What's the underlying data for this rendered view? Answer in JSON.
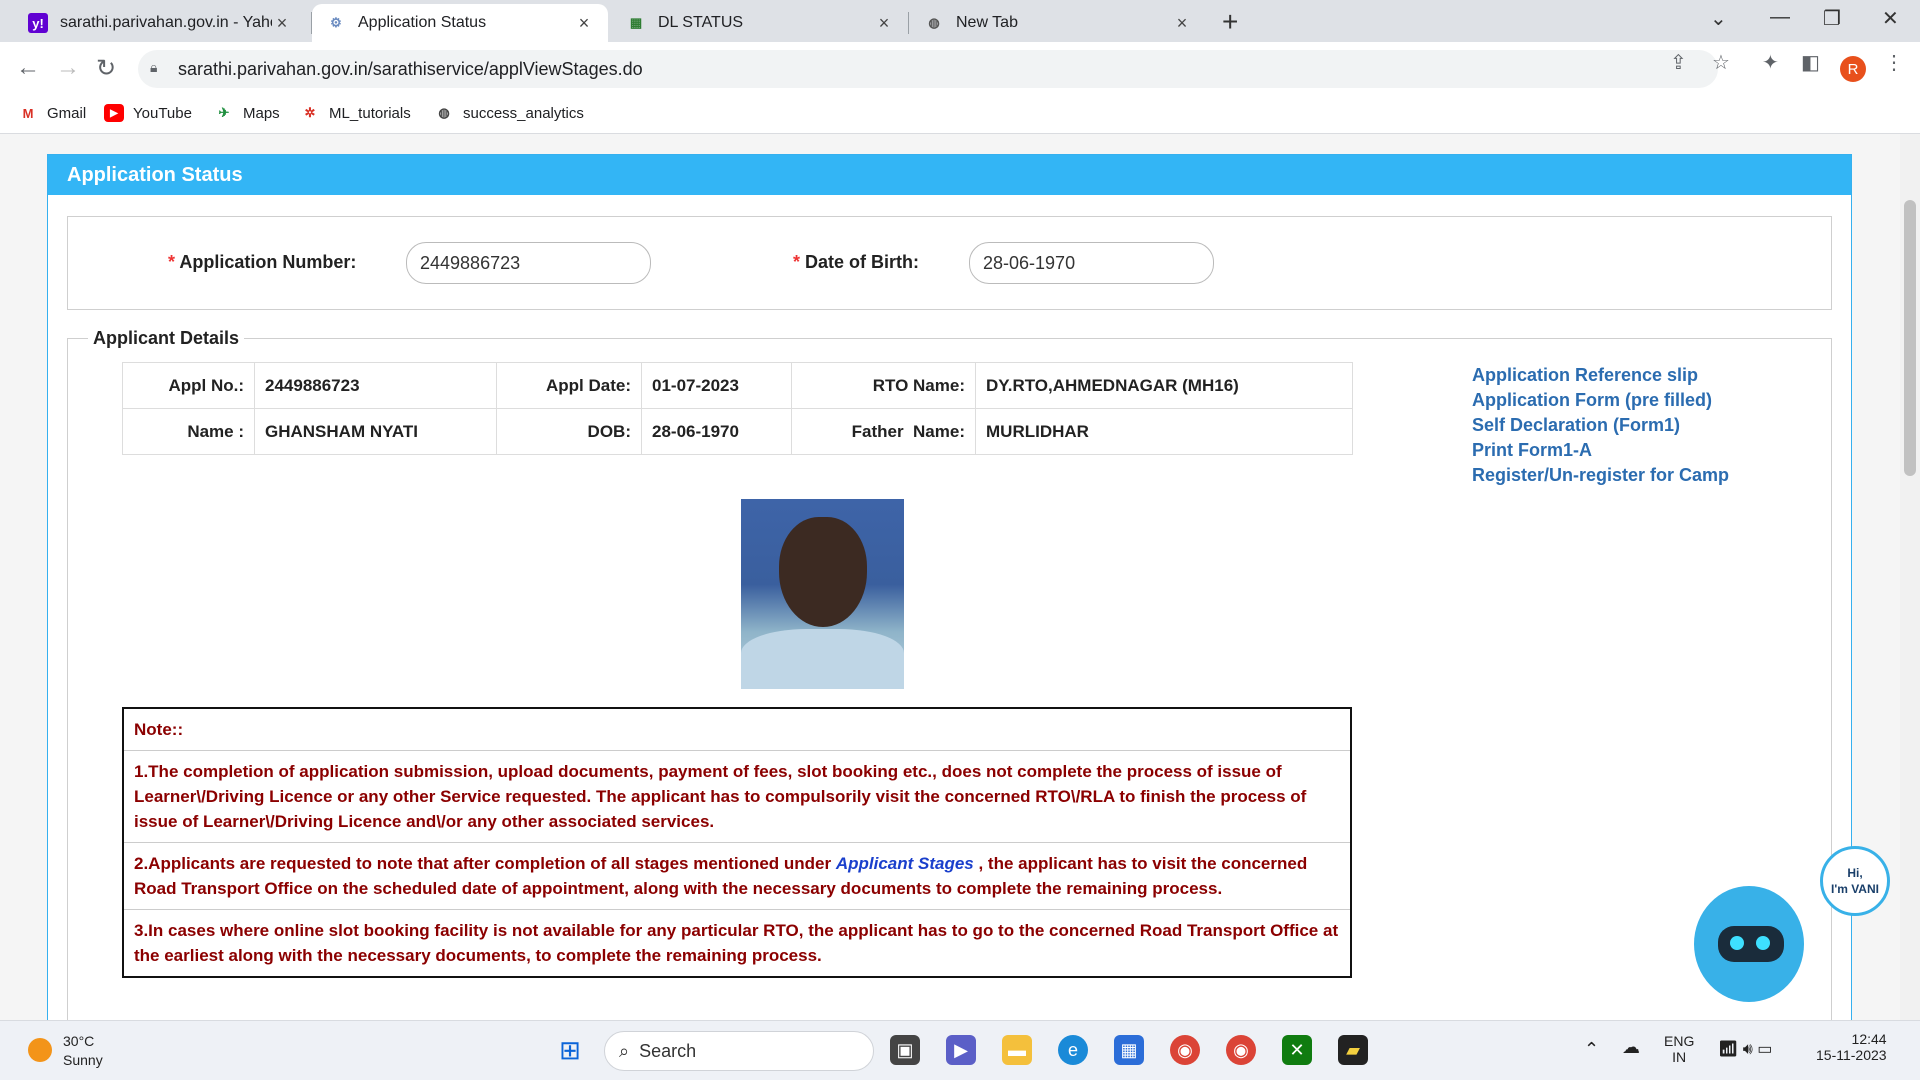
{
  "browser": {
    "tabs": [
      {
        "title": "sarathi.parivahan.gov.in - Yahoo",
        "favicon": "y!"
      },
      {
        "title": "Application Status",
        "favicon": "gear"
      },
      {
        "title": "DL STATUS",
        "favicon": "doc"
      },
      {
        "title": "New Tab",
        "favicon": "globe"
      }
    ],
    "url": "sarathi.parivahan.gov.in/sarathiservice/applViewStages.do",
    "profile_initial": "R",
    "bookmarks": [
      "Gmail",
      "YouTube",
      "Maps",
      "ML_tutorials",
      "success_analytics"
    ]
  },
  "page": {
    "header": "Application Status",
    "search": {
      "app_no_label": "Application Number:",
      "app_no_value": "2449886723",
      "dob_label": "Date of Birth:",
      "dob_value": "28-06-1970",
      "required_mark": "*"
    },
    "details": {
      "legend": "Applicant Details",
      "row1": {
        "appl_no_label": "Appl No.:",
        "appl_no": "2449886723",
        "appl_date_label": "Appl Date:",
        "appl_date": "01-07-2023",
        "rto_label": "RTO Name:",
        "rto": "DY.RTO,AHMEDNAGAR (MH16)"
      },
      "row2": {
        "name_label": "Name :",
        "name": "GHANSHAM NYATI",
        "dob_label": "DOB:",
        "dob": "28-06-1970",
        "father_label": "Father  Name:",
        "father": "MURLIDHAR"
      }
    },
    "links": [
      "Application Reference slip",
      "Application Form (pre filled)",
      "Self Declaration (Form1)",
      "Print Form1-A",
      "Register/Un-register for Camp"
    ],
    "note": {
      "title": "Note::",
      "p1": "1.The completion of application submission, upload documents, payment of fees, slot booking etc., does not complete the process of issue of Learner\\/Driving Licence or any other Service requested. The applicant has to compulsorily visit the concerned RTO\\/RLA to finish the process of issue of Learner\\/Driving Licence and\\/or any other associated services.",
      "p2_pre": "2.Applicants are requested to note that after completion of all stages mentioned under ",
      "p2_link": "Applicant Stages",
      "p2_post": " , the applicant has to visit the concerned Road Transport Office on the scheduled date of appointment, along with the necessary documents to complete the remaining process.",
      "p3": "3.In cases where online slot booking facility is not available for any particular RTO, the applicant has to go to the concerned Road Transport Office at the earliest along with the necessary documents, to complete the remaining process."
    },
    "chatbot": {
      "line1": "Hi,",
      "line2": "I'm VANI"
    }
  },
  "taskbar": {
    "temp": "30°C",
    "weather": "Sunny",
    "search_placeholder": "Search",
    "lang1": "ENG",
    "lang2": "IN",
    "time": "12:44",
    "date": "15-11-2023"
  }
}
